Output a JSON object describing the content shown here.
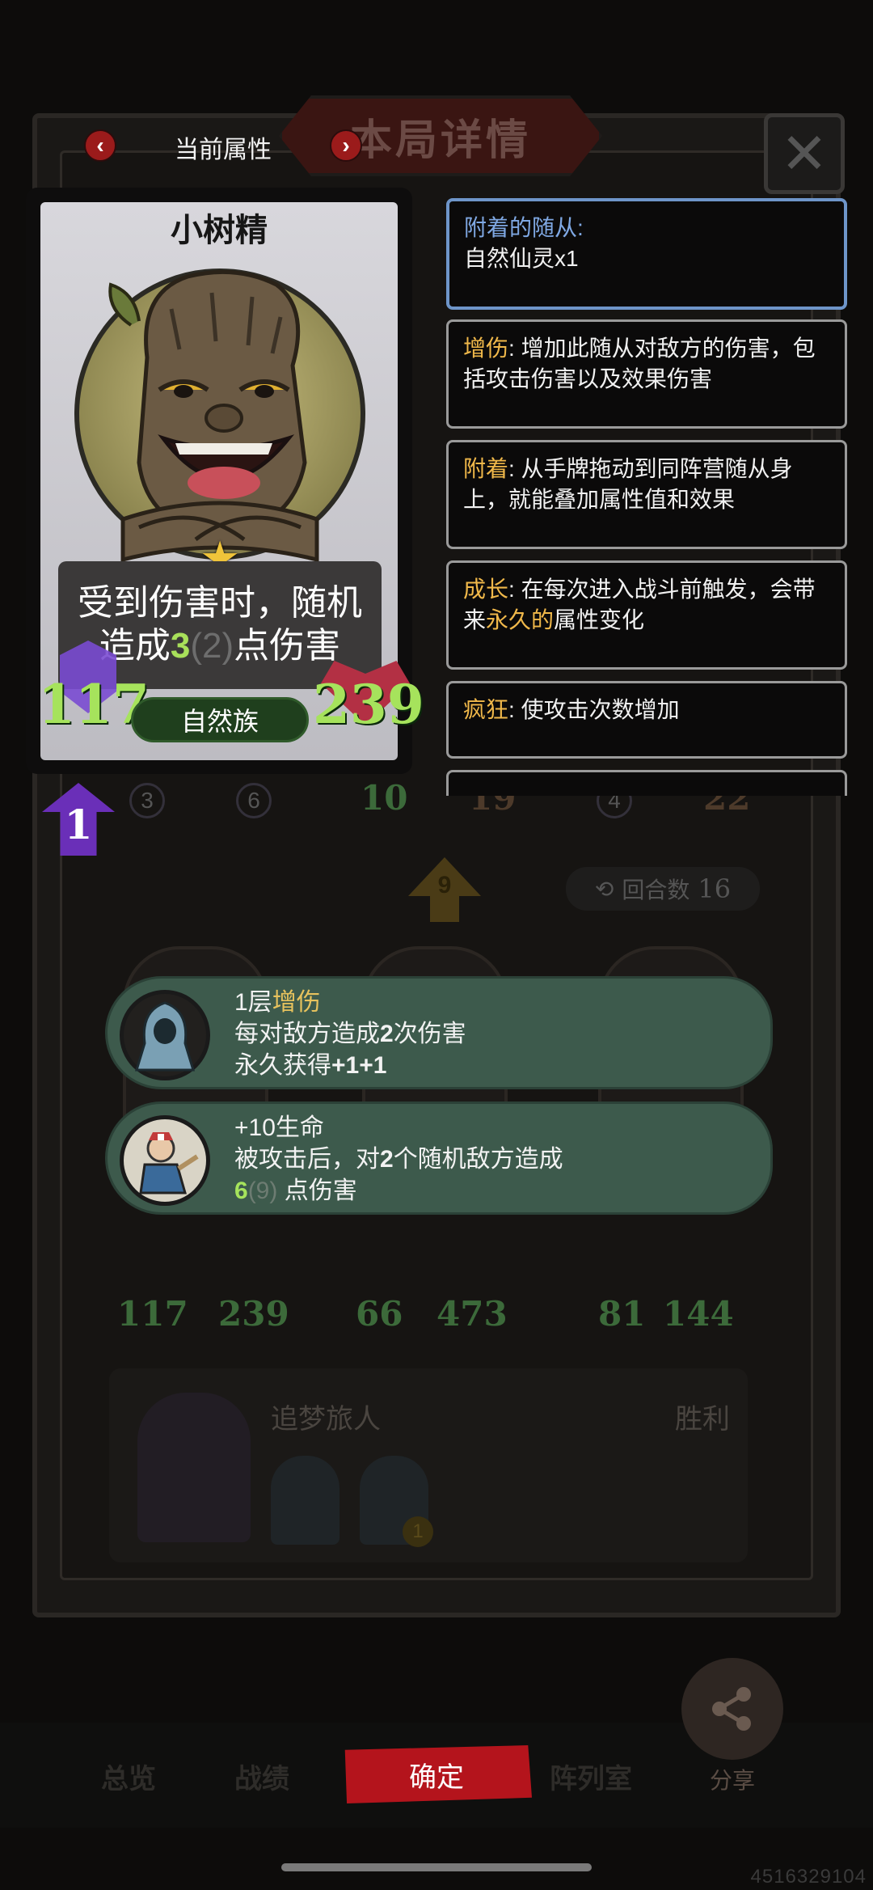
{
  "header": {
    "title": "本局详情",
    "attr_tab_label": "当前属性",
    "prev_arrow": "‹",
    "next_arrow": "›",
    "close_icon": "✕"
  },
  "card": {
    "name": "小树精",
    "effect_line1": "受到伤害时，随机",
    "effect_pre": "造成",
    "effect_value": "3",
    "effect_paren": "(2)",
    "effect_post": "点伤害",
    "race": "自然族",
    "attack": "117",
    "health": "239",
    "level": "1"
  },
  "keywords": {
    "attached_title": "附着的随从:",
    "attached_value": "自然仙灵x1",
    "items": [
      {
        "key": "增伤",
        "text": ": 增加此随从对敌方的伤害，包括攻击伤害以及效果伤害"
      },
      {
        "key": "附着",
        "text": ": 从手牌拖动到同阵营随从身上，就能叠加属性值和效果"
      },
      {
        "key": "成长",
        "text_pre": ": 在每次进入战斗前触发，会带来",
        "text_highlight": "永久的",
        "text_post": "属性变化"
      },
      {
        "key": "疯狂",
        "text": ": 使攻击次数增加"
      }
    ]
  },
  "background": {
    "row_top_values": [
      "3",
      "6",
      "10",
      "19",
      "4",
      "22"
    ],
    "round_label": "回合数",
    "round_value": "16",
    "arrow_value": "9",
    "row_bottom_values": [
      "117",
      "239",
      "66",
      "473",
      "81",
      "144"
    ],
    "player_name": "追梦旅人",
    "result": "胜利",
    "minion_badge": "1"
  },
  "buffs": [
    {
      "line1_pre": "1层",
      "line1_accent": "增伤",
      "line2_pre": "每对敌方造成",
      "line2_bold": "2",
      "line2_post": "次伤害",
      "line3_pre": "永久获得",
      "line3_bold": "+1+1"
    },
    {
      "line1": "+10生命",
      "line2_pre": "被攻击后，对",
      "line2_bold": "2",
      "line2_post": "个随机敌方造成",
      "line3_value": "6",
      "line3_dim": "(9)",
      "line3_post": "点伤害"
    }
  ],
  "bottom_nav": {
    "tabs": [
      "总览",
      "战绩",
      "阵列室"
    ],
    "confirm_label": "确定",
    "share_label": "分享"
  },
  "watermark": "4516329104",
  "colors": {
    "accent_gold": "#f0b84a",
    "stat_green": "#a6e35c",
    "confirm_red": "#b4141c",
    "attached_blue": "#6e95c9"
  }
}
